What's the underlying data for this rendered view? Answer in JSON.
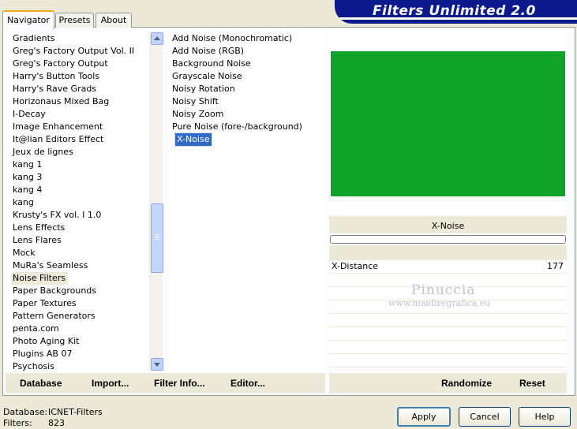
{
  "app_title": "Filters Unlimited 2.0",
  "tabs": [
    {
      "label": "Navigator"
    },
    {
      "label": "Presets"
    },
    {
      "label": "About"
    }
  ],
  "categories": [
    {
      "label": "Gradients"
    },
    {
      "label": "Greg's Factory Output Vol. II"
    },
    {
      "label": "Greg's Factory Output"
    },
    {
      "label": "Harry's Button Tools"
    },
    {
      "label": "Harry's Rave Grads"
    },
    {
      "label": "Horizonaus Mixed Bag"
    },
    {
      "label": "I-Decay"
    },
    {
      "label": "Image Enhancement"
    },
    {
      "label": "It@lian Editors Effect"
    },
    {
      "label": "Jeux de lignes"
    },
    {
      "label": "kang 1"
    },
    {
      "label": "kang 3"
    },
    {
      "label": "kang 4"
    },
    {
      "label": "kang"
    },
    {
      "label": "Krusty's FX vol. I 1.0"
    },
    {
      "label": "Lens Effects"
    },
    {
      "label": "Lens Flares"
    },
    {
      "label": "Mock"
    },
    {
      "label": "MuRa's Seamless"
    },
    {
      "label": "Noise Filters"
    },
    {
      "label": "Paper Backgrounds"
    },
    {
      "label": "Paper Textures"
    },
    {
      "label": "Pattern Generators"
    },
    {
      "label": "penta.com"
    },
    {
      "label": "Photo Aging Kit"
    },
    {
      "label": "Plugins AB 07"
    },
    {
      "label": "Psychosis"
    }
  ],
  "selected_category": "Noise Filters",
  "filters": [
    {
      "label": "Add Noise (Monochromatic)"
    },
    {
      "label": "Add Noise (RGB)"
    },
    {
      "label": "Background Noise"
    },
    {
      "label": "Grayscale Noise"
    },
    {
      "label": "Noisy Rotation"
    },
    {
      "label": "Noisy Shift"
    },
    {
      "label": "Noisy Zoom"
    },
    {
      "label": "Pure Noise (fore-/background)"
    },
    {
      "label": "X-Noise"
    }
  ],
  "selected_filter": "X-Noise",
  "preview": {
    "filter_name": "X-Noise",
    "color": "#11a22a",
    "progress": 0
  },
  "params": [
    {
      "label": "X-Distance",
      "value": "177"
    }
  ],
  "watermark": {
    "line1": "Pinuccia",
    "line2": "www.maidiregrafica.eu"
  },
  "bottom_links": {
    "database": "Database",
    "import": "Import...",
    "filter_info": "Filter Info...",
    "editor": "Editor...",
    "randomize": "Randomize",
    "reset": "Reset"
  },
  "buttons": {
    "apply": "Apply",
    "cancel": "Cancel",
    "help": "Help"
  },
  "status": {
    "database_label": "Database:",
    "database_value": "ICNET-Filters",
    "filters_label": "Filters:",
    "filters_value": "823"
  },
  "colors": {
    "selection": "#316ac5",
    "header": "#0c1a8c",
    "tab_highlight": "#f5a623"
  }
}
